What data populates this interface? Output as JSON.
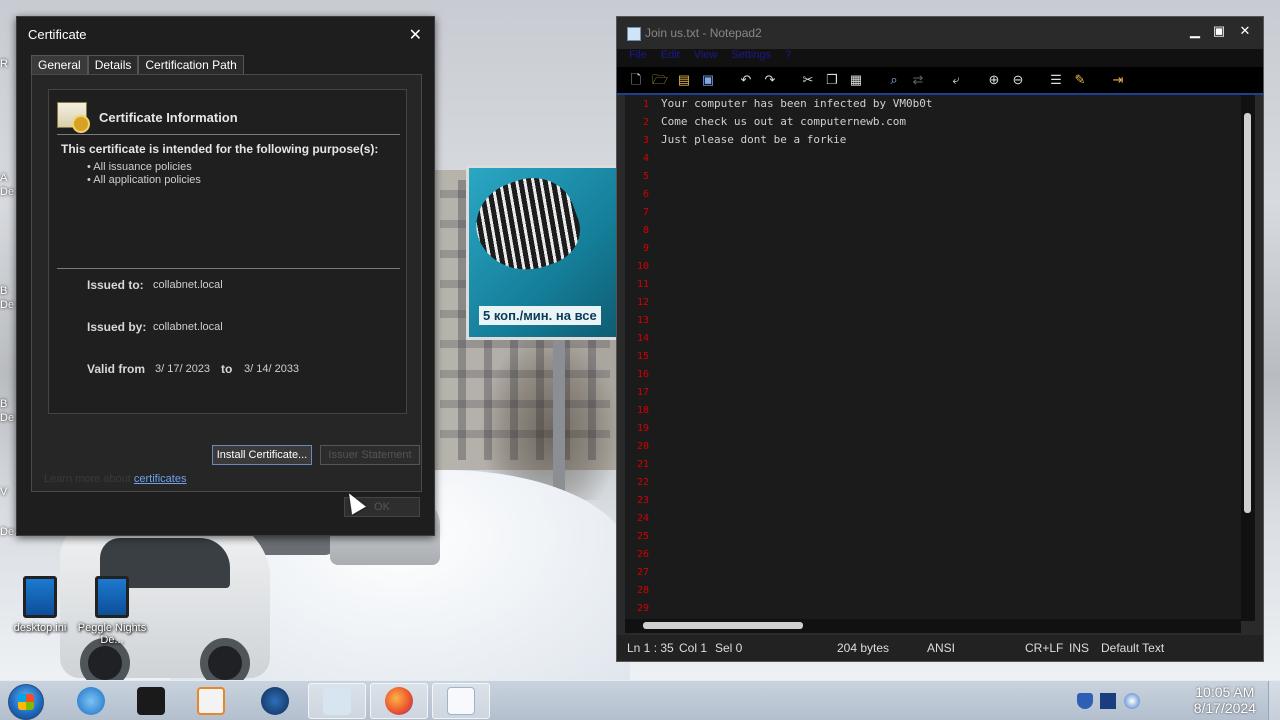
{
  "desktop": {
    "icons": [
      {
        "label": "desktop.ini"
      },
      {
        "label": "Peggle Nights De..."
      }
    ],
    "edge_labels": [
      "R",
      "A",
      "De",
      "B",
      "De",
      "B",
      "De",
      "De",
      "V"
    ],
    "billboard_text": "5 коп./мин. на все"
  },
  "cert_dialog": {
    "title": "Certificate",
    "tabs": [
      "General",
      "Details",
      "Certification Path"
    ],
    "info_heading": "Certificate Information",
    "purpose_heading": "This certificate is intended for the following purpose(s):",
    "purposes": [
      "• All issuance policies",
      "• All application policies"
    ],
    "issued_to_label": "Issued to:",
    "issued_to_value": "collabnet.local",
    "issued_by_label": "Issued by:",
    "issued_by_value": "collabnet.local",
    "valid_from_label": "Valid from",
    "valid_from_value": "3/ 17/ 2023",
    "valid_to_label": "to",
    "valid_to_value": "3/ 14/ 2033",
    "install_button": "Install Certificate...",
    "issuer_button": "Issuer Statement",
    "learn_more_prefix": "Learn more about ",
    "learn_more_link": "certificates",
    "ok_button": "OK"
  },
  "notepad": {
    "title": "Join us.txt - Notepad2",
    "menu": [
      "File",
      "Edit",
      "View",
      "Settings",
      "?"
    ],
    "lines": [
      "Your computer has been infected by VM0b0t",
      "Come check us out at computernewb.com",
      "Just please dont be a forkie"
    ],
    "line_numbers": [
      "1",
      "2",
      "3",
      "4",
      "5",
      "6",
      "7",
      "8",
      "9",
      "10",
      "11",
      "12",
      "13",
      "14",
      "15",
      "16",
      "17",
      "18",
      "19",
      "20",
      "21",
      "22",
      "23",
      "24",
      "25",
      "26",
      "27",
      "28",
      "29"
    ],
    "status": {
      "position": "Ln 1 : 35",
      "col": "Col 1",
      "sel": "Sel 0",
      "size": "204 bytes",
      "encoding": "ANSI",
      "eol": "CR+LF",
      "mode": "INS",
      "scheme": "Default Text"
    }
  },
  "taskbar": {
    "time": "10:05 AM",
    "date": "8/17/2024"
  }
}
